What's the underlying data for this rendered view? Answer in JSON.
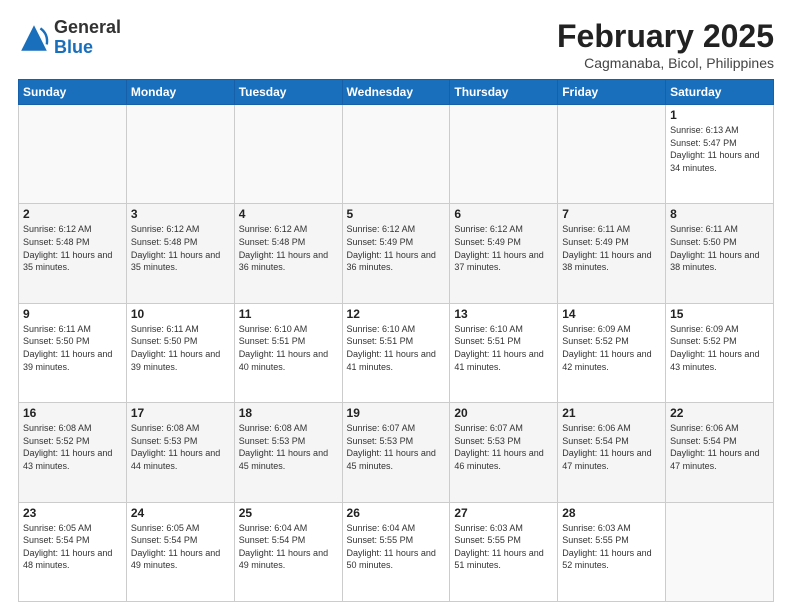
{
  "logo": {
    "general": "General",
    "blue": "Blue"
  },
  "header": {
    "month": "February 2025",
    "location": "Cagmanaba, Bicol, Philippines"
  },
  "weekdays": [
    "Sunday",
    "Monday",
    "Tuesday",
    "Wednesday",
    "Thursday",
    "Friday",
    "Saturday"
  ],
  "weeks": [
    [
      {
        "day": "",
        "info": ""
      },
      {
        "day": "",
        "info": ""
      },
      {
        "day": "",
        "info": ""
      },
      {
        "day": "",
        "info": ""
      },
      {
        "day": "",
        "info": ""
      },
      {
        "day": "",
        "info": ""
      },
      {
        "day": "1",
        "info": "Sunrise: 6:13 AM\nSunset: 5:47 PM\nDaylight: 11 hours and 34 minutes."
      }
    ],
    [
      {
        "day": "2",
        "info": "Sunrise: 6:12 AM\nSunset: 5:48 PM\nDaylight: 11 hours and 35 minutes."
      },
      {
        "day": "3",
        "info": "Sunrise: 6:12 AM\nSunset: 5:48 PM\nDaylight: 11 hours and 35 minutes."
      },
      {
        "day": "4",
        "info": "Sunrise: 6:12 AM\nSunset: 5:48 PM\nDaylight: 11 hours and 36 minutes."
      },
      {
        "day": "5",
        "info": "Sunrise: 6:12 AM\nSunset: 5:49 PM\nDaylight: 11 hours and 36 minutes."
      },
      {
        "day": "6",
        "info": "Sunrise: 6:12 AM\nSunset: 5:49 PM\nDaylight: 11 hours and 37 minutes."
      },
      {
        "day": "7",
        "info": "Sunrise: 6:11 AM\nSunset: 5:49 PM\nDaylight: 11 hours and 38 minutes."
      },
      {
        "day": "8",
        "info": "Sunrise: 6:11 AM\nSunset: 5:50 PM\nDaylight: 11 hours and 38 minutes."
      }
    ],
    [
      {
        "day": "9",
        "info": "Sunrise: 6:11 AM\nSunset: 5:50 PM\nDaylight: 11 hours and 39 minutes."
      },
      {
        "day": "10",
        "info": "Sunrise: 6:11 AM\nSunset: 5:50 PM\nDaylight: 11 hours and 39 minutes."
      },
      {
        "day": "11",
        "info": "Sunrise: 6:10 AM\nSunset: 5:51 PM\nDaylight: 11 hours and 40 minutes."
      },
      {
        "day": "12",
        "info": "Sunrise: 6:10 AM\nSunset: 5:51 PM\nDaylight: 11 hours and 41 minutes."
      },
      {
        "day": "13",
        "info": "Sunrise: 6:10 AM\nSunset: 5:51 PM\nDaylight: 11 hours and 41 minutes."
      },
      {
        "day": "14",
        "info": "Sunrise: 6:09 AM\nSunset: 5:52 PM\nDaylight: 11 hours and 42 minutes."
      },
      {
        "day": "15",
        "info": "Sunrise: 6:09 AM\nSunset: 5:52 PM\nDaylight: 11 hours and 43 minutes."
      }
    ],
    [
      {
        "day": "16",
        "info": "Sunrise: 6:08 AM\nSunset: 5:52 PM\nDaylight: 11 hours and 43 minutes."
      },
      {
        "day": "17",
        "info": "Sunrise: 6:08 AM\nSunset: 5:53 PM\nDaylight: 11 hours and 44 minutes."
      },
      {
        "day": "18",
        "info": "Sunrise: 6:08 AM\nSunset: 5:53 PM\nDaylight: 11 hours and 45 minutes."
      },
      {
        "day": "19",
        "info": "Sunrise: 6:07 AM\nSunset: 5:53 PM\nDaylight: 11 hours and 45 minutes."
      },
      {
        "day": "20",
        "info": "Sunrise: 6:07 AM\nSunset: 5:53 PM\nDaylight: 11 hours and 46 minutes."
      },
      {
        "day": "21",
        "info": "Sunrise: 6:06 AM\nSunset: 5:54 PM\nDaylight: 11 hours and 47 minutes."
      },
      {
        "day": "22",
        "info": "Sunrise: 6:06 AM\nSunset: 5:54 PM\nDaylight: 11 hours and 47 minutes."
      }
    ],
    [
      {
        "day": "23",
        "info": "Sunrise: 6:05 AM\nSunset: 5:54 PM\nDaylight: 11 hours and 48 minutes."
      },
      {
        "day": "24",
        "info": "Sunrise: 6:05 AM\nSunset: 5:54 PM\nDaylight: 11 hours and 49 minutes."
      },
      {
        "day": "25",
        "info": "Sunrise: 6:04 AM\nSunset: 5:54 PM\nDaylight: 11 hours and 49 minutes."
      },
      {
        "day": "26",
        "info": "Sunrise: 6:04 AM\nSunset: 5:55 PM\nDaylight: 11 hours and 50 minutes."
      },
      {
        "day": "27",
        "info": "Sunrise: 6:03 AM\nSunset: 5:55 PM\nDaylight: 11 hours and 51 minutes."
      },
      {
        "day": "28",
        "info": "Sunrise: 6:03 AM\nSunset: 5:55 PM\nDaylight: 11 hours and 52 minutes."
      },
      {
        "day": "",
        "info": ""
      }
    ]
  ]
}
